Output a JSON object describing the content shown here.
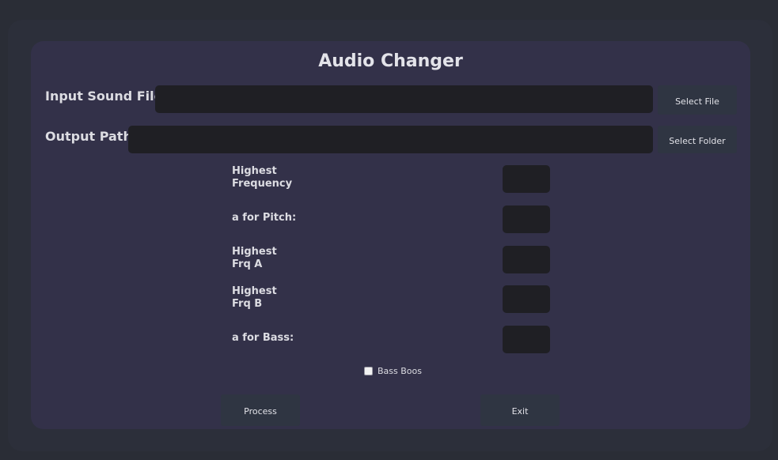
{
  "app": {
    "title": "Audio Changer"
  },
  "input_file": {
    "label": "Input Sound File",
    "value": "",
    "button_label": "Select File"
  },
  "output_path": {
    "label": "Output Path",
    "value": "",
    "button_label": "Select Folder"
  },
  "params": [
    {
      "label_lines": [
        "Highest",
        "Frequency"
      ],
      "value": ""
    },
    {
      "label_lines": [
        "a for Pitch:"
      ],
      "value": ""
    },
    {
      "label_lines": [
        "Highest",
        "Frq A"
      ],
      "value": ""
    },
    {
      "label_lines": [
        "Highest",
        "Frq B"
      ],
      "value": ""
    },
    {
      "label_lines": [
        "a for Bass:"
      ],
      "value": ""
    }
  ],
  "bass_boost": {
    "label": "Bass Boos",
    "checked": false
  },
  "actions": {
    "process_label": "Process",
    "exit_label": "Exit"
  },
  "colors": {
    "window_bg": "#2c2f3a",
    "panel_bg": "#333149",
    "field_bg": "#1f1f24",
    "button_bg": "#2f3542"
  }
}
